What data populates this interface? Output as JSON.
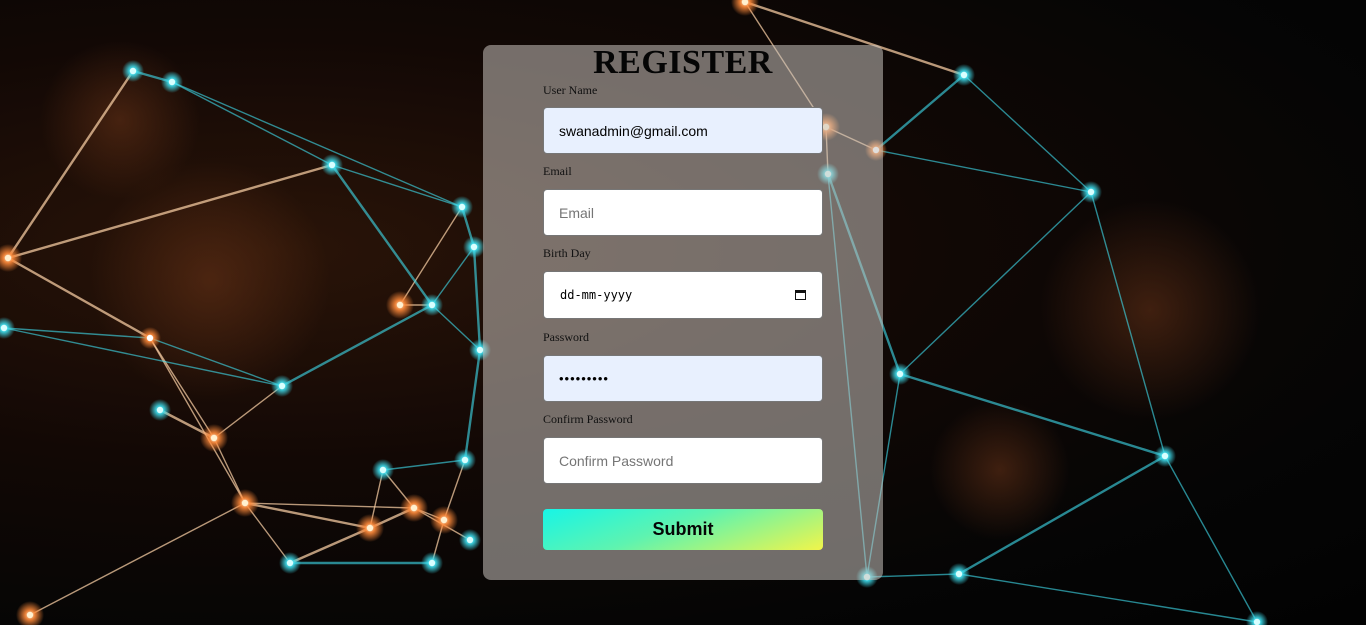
{
  "form": {
    "title": "REGISTER",
    "username": {
      "label": "User Name",
      "value": "swanadmin@gmail.com",
      "placeholder": "User Name"
    },
    "email": {
      "label": "Email",
      "value": "",
      "placeholder": "Email"
    },
    "birthday": {
      "label": "Birth Day",
      "display": "dd-mm-yyyy",
      "icon": "calendar-icon"
    },
    "password": {
      "label": "Password",
      "value": "•••••••••"
    },
    "confirm_password": {
      "label": "Confirm Password",
      "value": "",
      "placeholder": "Confirm Password"
    },
    "submit_label": "Submit"
  },
  "colors": {
    "card_bg": "#c8c3be",
    "autofill_bg": "#e8f0fe",
    "button_gradient_start": "#17f5e6",
    "button_gradient_end": "#f1f54a",
    "network_cyan": "#3fe0f0",
    "network_orange": "#ff8a3a"
  }
}
